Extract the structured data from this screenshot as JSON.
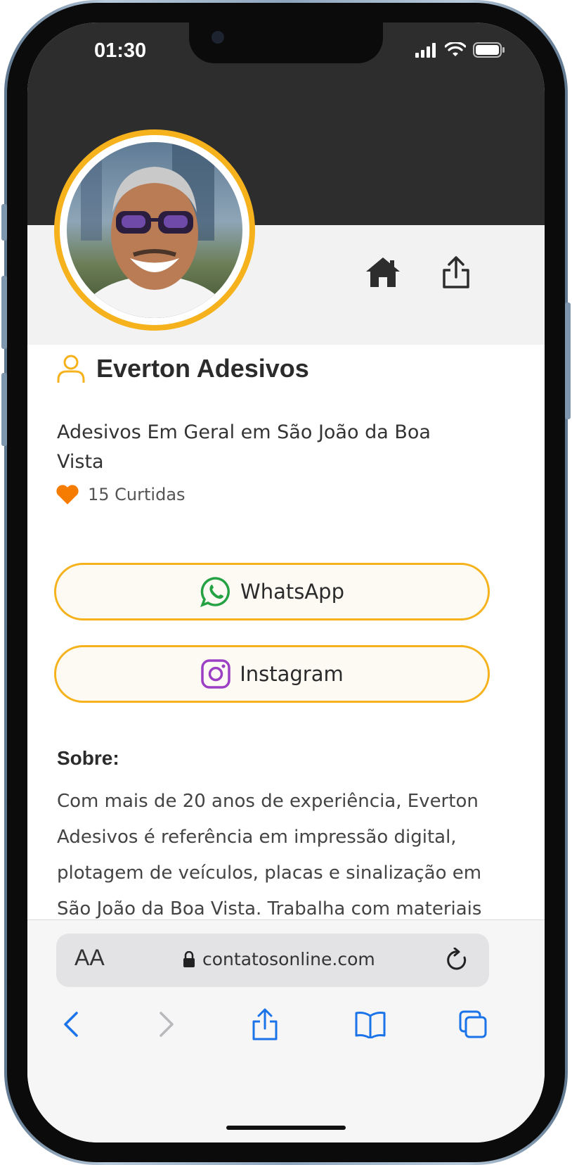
{
  "status_bar": {
    "time": "01:30"
  },
  "profile": {
    "name": "Everton Adesivos",
    "tagline": "Adesivos Em Geral em São João da Boa Vista",
    "likes": "15 Curtidas"
  },
  "buttons": {
    "whatsapp": "WhatsApp",
    "instagram": "Instagram"
  },
  "about": {
    "title": "Sobre:",
    "text": "Com mais de 20 anos de experiência, Everton Adesivos é referência em impressão digital, plotagem de veículos, placas e sinalização em São João da Boa Vista. Trabalha com materiais"
  },
  "browser": {
    "aa_label": "AA",
    "url": "contatosonline.com"
  },
  "colors": {
    "accent": "#f5b21d",
    "header_bg": "#2d2d2d",
    "heart": "#f57c00",
    "whatsapp": "#25a244",
    "instagram": "#9b3fc5",
    "ios_blue": "#1a73e8"
  }
}
